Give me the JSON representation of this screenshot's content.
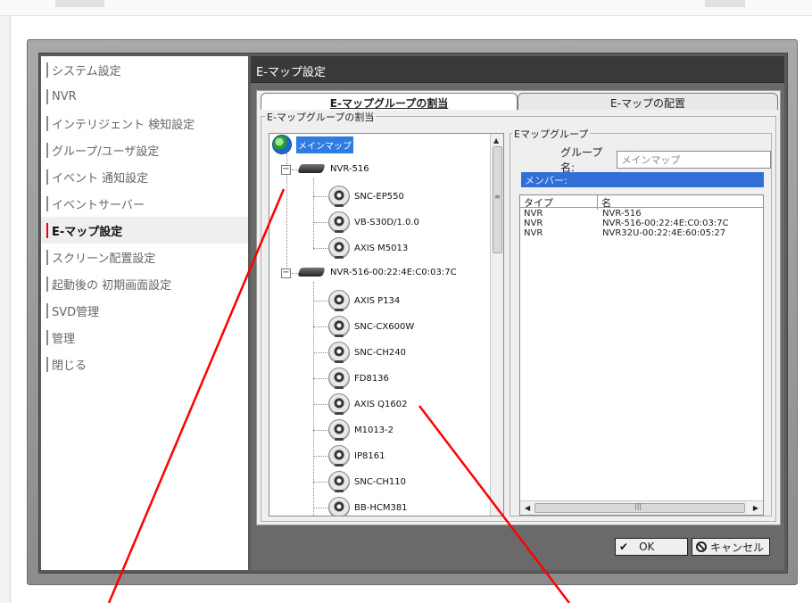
{
  "dialog_title": "E-マップ設定",
  "menu": {
    "items": [
      {
        "label": "システム設定",
        "active": false
      },
      {
        "label": "NVR",
        "active": false
      },
      {
        "label": "インテリジェント 検知設定",
        "active": false
      },
      {
        "label": "グループ/ユーザ設定",
        "active": false
      },
      {
        "label": "イベント 通知設定",
        "active": false
      },
      {
        "label": "イベントサーバー",
        "active": false
      },
      {
        "label": "E-マップ設定",
        "active": true
      },
      {
        "label": "スクリーン配置設定",
        "active": false
      },
      {
        "label": "起動後の 初期画面設定",
        "active": false
      },
      {
        "label": "SVD管理",
        "active": false
      },
      {
        "label": "管理",
        "active": false
      },
      {
        "label": "閉じる",
        "active": false
      }
    ]
  },
  "tabs": {
    "group_assign": "E-マップグループの割当",
    "layout": "E-マップの配置"
  },
  "section_label": "E-マップグループの割当",
  "tree": {
    "root": "メインマップ",
    "nvr1": {
      "name": "NVR-516",
      "cameras": [
        "SNC-EP550",
        "VB-S30D/1.0.0",
        "AXIS M5013"
      ]
    },
    "nvr2": {
      "name": "NVR-516-00:22:4E:C0:03:7C",
      "cameras": [
        "AXIS P134",
        "SNC-CX600W",
        "SNC-CH240",
        "FD8136",
        "AXIS Q1602",
        "M1013-2",
        "IP8161",
        "SNC-CH110",
        "BB-HCM381"
      ]
    }
  },
  "group_panel": {
    "legend": "Eマップグループ",
    "name_label": "グループ名:",
    "name_value": "メインマップ",
    "members_label": "メンバー:",
    "columns": [
      "タイプ",
      "名"
    ],
    "rows": [
      [
        "NVR",
        "NVR-516"
      ],
      [
        "NVR",
        "NVR-516-00:22:4E:C0:03:7C"
      ],
      [
        "NVR",
        "NVR32U-00:22:4E:60:05:27"
      ]
    ]
  },
  "buttons": {
    "ok": "OK",
    "cancel": "キャンセル"
  },
  "colors": {
    "accent_red": "#e60012",
    "selection_blue": "#2f7be2",
    "members_bar": "#2f6fd6",
    "title_bar": "#3a3a3a"
  }
}
